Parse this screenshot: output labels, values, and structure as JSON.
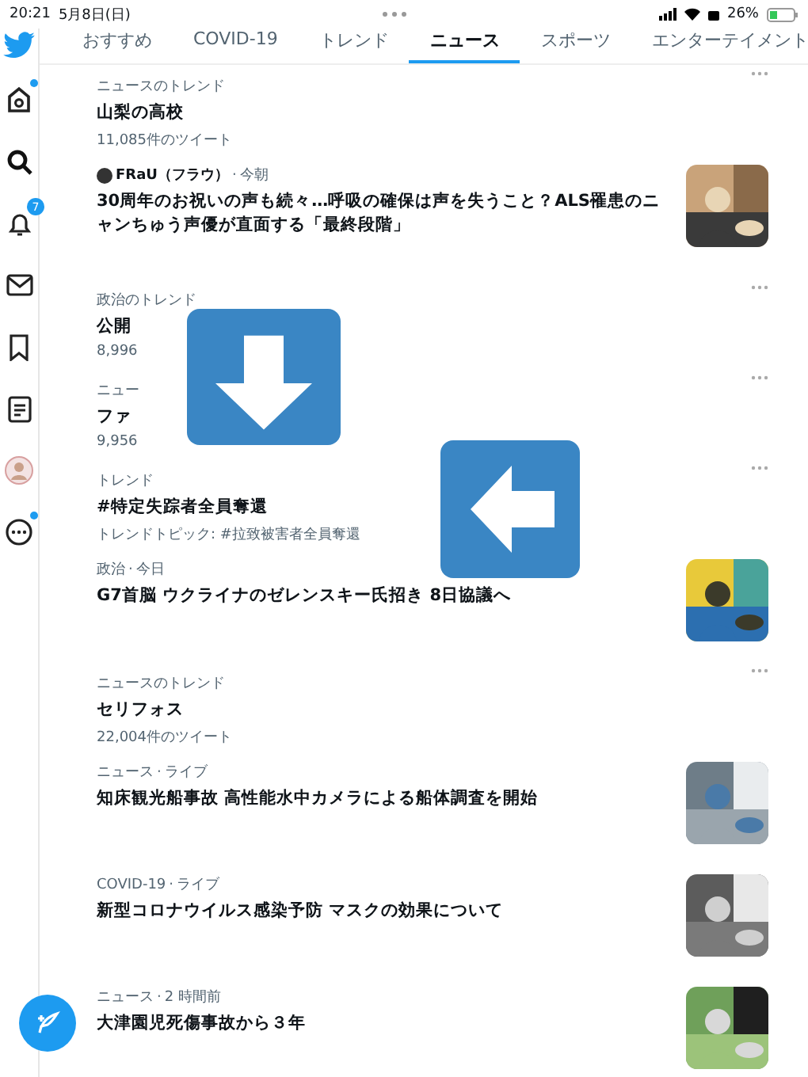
{
  "status_bar": {
    "time": "20:21",
    "date": "5月8日(日)",
    "battery": "26%"
  },
  "sidebar": {
    "items": [
      {
        "kind": "home",
        "badge_dot": true
      },
      {
        "kind": "search"
      },
      {
        "kind": "bell",
        "badge": "7"
      },
      {
        "kind": "mail"
      },
      {
        "kind": "bookmark"
      },
      {
        "kind": "list"
      },
      {
        "kind": "avatar"
      },
      {
        "kind": "more",
        "badge_dot": true
      }
    ]
  },
  "tabs": [
    {
      "label": "おすすめ",
      "selected": false
    },
    {
      "label": "COVID-19",
      "selected": false
    },
    {
      "label": "トレンド",
      "selected": false
    },
    {
      "label": "ニュース",
      "selected": true
    },
    {
      "label": "スポーツ",
      "selected": false
    },
    {
      "label": "エンターテイメント",
      "selected": false
    }
  ],
  "items": [
    {
      "kind": "trend",
      "category": "ニュースのトレンド",
      "title": "山梨の高校",
      "meta": "11,085件のツイート"
    },
    {
      "kind": "news",
      "source": "FRaU（フラウ）",
      "separator": "·",
      "time": "今朝",
      "title": "30周年のお祝いの声も続々…呼吸の確保は声を失うこと？ALS罹患のニャンちゅう声優が直面する「最終段階」"
    },
    {
      "kind": "trend",
      "category": "政治のトレンド",
      "title": "公開",
      "meta": "8,996"
    },
    {
      "kind": "trend",
      "category": "ニュー",
      "title": "ファ",
      "meta": "9,956"
    },
    {
      "kind": "trend",
      "category": "トレンド",
      "title": "#特定失踪者全員奪還",
      "meta": "トレンドトピック: #拉致被害者全員奪還"
    },
    {
      "kind": "news",
      "category": "政治",
      "separator": "·",
      "time": "今日",
      "title": "G7首脳 ウクライナのゼレンスキー氏招き 8日協議へ"
    },
    {
      "kind": "trend",
      "category": "ニュースのトレンド",
      "title": "セリフォス",
      "meta": "22,004件のツイート"
    },
    {
      "kind": "news",
      "category": "ニュース",
      "separator": "·",
      "time": "ライブ",
      "title": "知床観光船事故 高性能水中カメラによる船体調査を開始"
    },
    {
      "kind": "news",
      "category": "COVID-19",
      "separator": "·",
      "time": "ライブ",
      "title": "新型コロナウイルス感染予防 マスクの効果について"
    },
    {
      "kind": "news",
      "category": "ニュース",
      "separator": "·",
      "time": "2 時間前",
      "title": "大津園児死傷事故から３年"
    }
  ],
  "overlays": [
    {
      "kind": "down"
    },
    {
      "kind": "left"
    }
  ]
}
